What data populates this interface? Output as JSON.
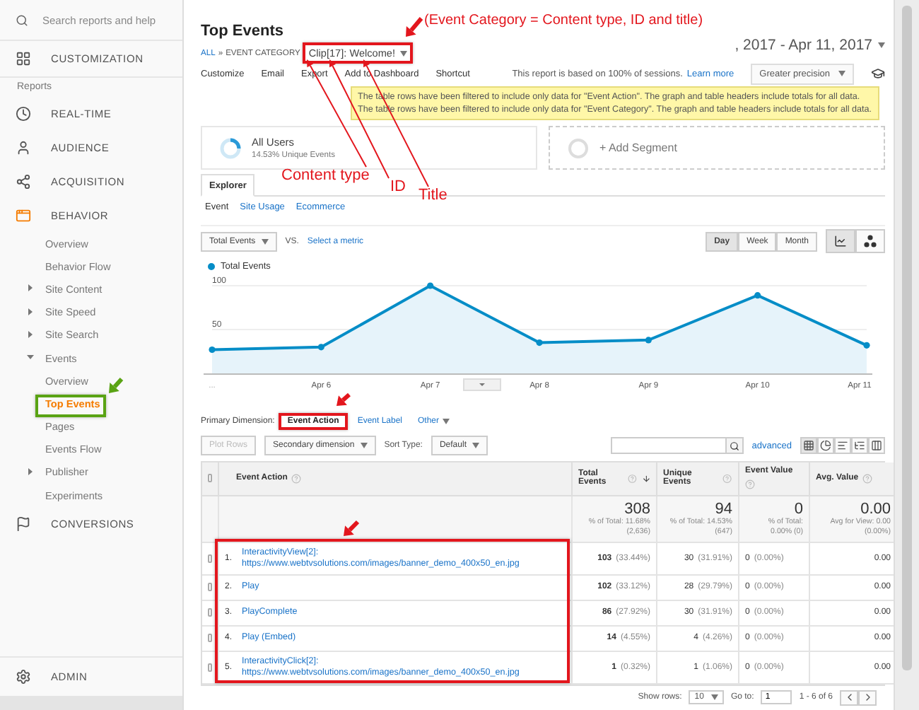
{
  "sidebar": {
    "search": {
      "placeholder": "Search reports and help"
    },
    "customization": "CUSTOMIZATION",
    "reports_heading": "Reports",
    "items": [
      {
        "label": "REAL-TIME",
        "selected": false
      },
      {
        "label": "AUDIENCE",
        "selected": false
      },
      {
        "label": "ACQUISITION",
        "selected": false
      },
      {
        "label": "BEHAVIOR",
        "selected": true,
        "children": [
          {
            "label": "Overview",
            "selected": false
          },
          {
            "label": "Behavior Flow",
            "selected": false
          },
          {
            "label": "Site Content",
            "selected": false,
            "expanded": false
          },
          {
            "label": "Site Speed",
            "selected": false,
            "expanded": false
          },
          {
            "label": "Site Search",
            "selected": false,
            "expanded": false
          },
          {
            "label": "Events",
            "selected": false,
            "expanded": true,
            "children": [
              {
                "label": "Overview",
                "selected": false
              },
              {
                "label": "Top Events",
                "selected": true
              },
              {
                "label": "Pages",
                "selected": false
              },
              {
                "label": "Events Flow",
                "selected": false
              }
            ]
          },
          {
            "label": "Publisher",
            "selected": false,
            "expanded": false
          },
          {
            "label": "Experiments",
            "selected": false
          }
        ]
      },
      {
        "label": "CONVERSIONS",
        "selected": false
      }
    ],
    "admin": "ADMIN"
  },
  "header": {
    "title": "Top Events",
    "breadcrumb": {
      "root": "ALL",
      "separator": "»",
      "level": "EVENT CATEGORY",
      "value": "Clip[17]: Welcome!"
    },
    "date_range": ", 2017 - Apr 11, 2017"
  },
  "toolbar": {
    "actions": [
      "Customize",
      "Email",
      "Export",
      "Add to Dashboard",
      "Shortcut"
    ],
    "sampling_text": "This report is based on 100% of sessions.",
    "learn_more": "Learn more",
    "precision": "Greater precision"
  },
  "notice": [
    "The table rows have been filtered to include only data for \"Event Action\". The graph and table headers include totals for all data.",
    "The table rows have been filtered to include only data for \"Event Category\". The graph and table headers include totals for all data."
  ],
  "segments": [
    {
      "name": "All Users",
      "detail": "14.53% Unique Events"
    }
  ],
  "add_segment": "+ Add Segment",
  "tabs": [
    {
      "label": "Explorer",
      "selected": true
    }
  ],
  "subtabs": [
    {
      "label": "Event",
      "selected": true
    },
    {
      "label": "Site Usage",
      "selected": false
    },
    {
      "label": "Ecommerce",
      "selected": false
    }
  ],
  "chart_controls": {
    "metric": "Total Events",
    "vs": "VS.",
    "select_metric": "Select a metric",
    "granularity": [
      {
        "label": "Day",
        "selected": true
      },
      {
        "label": "Week",
        "selected": false
      },
      {
        "label": "Month",
        "selected": false
      }
    ]
  },
  "chart": {
    "chart_data": {
      "type": "area",
      "categories": [
        "...",
        "Apr 6",
        "Apr 7",
        "Apr 8",
        "Apr 9",
        "Apr 10",
        "Apr 11"
      ],
      "ylim": [
        0,
        100
      ],
      "yticks": [
        {
          "value": 50,
          "label": "50"
        },
        {
          "value": 100,
          "label": "100"
        }
      ],
      "series": [
        {
          "name": "Total Events",
          "color": "#058dc7",
          "values": [
            27,
            30,
            100,
            35,
            38,
            89,
            32
          ]
        }
      ]
    }
  },
  "primary_dimension": {
    "label": "Primary Dimension:",
    "options": [
      {
        "label": "Event Action",
        "selected": true
      },
      {
        "label": "Event Label",
        "selected": false
      },
      {
        "label": "Other",
        "selected": false
      }
    ]
  },
  "table_controls": {
    "plot_rows": "Plot Rows",
    "plot_rows_disabled": true,
    "secondary_dimension": "Secondary dimension",
    "sort_label": "Sort Type:",
    "sort": "Default",
    "advanced": "advanced"
  },
  "table": {
    "select_all_checked": false,
    "columns": [
      "Event Action",
      "Total Events",
      "Unique Events",
      "Event Value",
      "Avg. Value"
    ],
    "totals": [
      {
        "value": "308",
        "note": "% of Total: 11.68% (2,636)"
      },
      {
        "value": "94",
        "note": "% of Total: 14.53% (647)"
      },
      {
        "value": "0",
        "note": "% of Total: 0.00% (0)"
      },
      {
        "value": "0.00",
        "note": "Avg for View: 0.00 (0.00%)"
      }
    ],
    "rows": [
      {
        "index": "1.",
        "action": "InteractivityView[2]: https://www.webtvsolutions.com/images/banner_demo_400x50_en.jpg",
        "checked": false,
        "total": "103",
        "total_pct": "(33.44%)",
        "unique": "30",
        "unique_pct": "(31.91%)",
        "value": "0",
        "value_pct": "(0.00%)",
        "avg": "0.00"
      },
      {
        "index": "2.",
        "action": "Play",
        "checked": false,
        "total": "102",
        "total_pct": "(33.12%)",
        "unique": "28",
        "unique_pct": "(29.79%)",
        "value": "0",
        "value_pct": "(0.00%)",
        "avg": "0.00"
      },
      {
        "index": "3.",
        "action": "PlayComplete",
        "checked": false,
        "total": "86",
        "total_pct": "(27.92%)",
        "unique": "30",
        "unique_pct": "(31.91%)",
        "value": "0",
        "value_pct": "(0.00%)",
        "avg": "0.00"
      },
      {
        "index": "4.",
        "action": "Play (Embed)",
        "checked": false,
        "total": "14",
        "total_pct": "(4.55%)",
        "unique": "4",
        "unique_pct": "(4.26%)",
        "value": "0",
        "value_pct": "(0.00%)",
        "avg": "0.00"
      },
      {
        "index": "5.",
        "action": "InteractivityClick[2]: https://www.webtvsolutions.com/images/banner_demo_400x50_en.jpg",
        "checked": false,
        "total": "1",
        "total_pct": "(0.32%)",
        "unique": "1",
        "unique_pct": "(1.06%)",
        "value": "0",
        "value_pct": "(0.00%)",
        "avg": "0.00"
      }
    ],
    "footer": {
      "show_rows_label": "Show rows:",
      "show_rows": "10",
      "goto_label": "Go to:",
      "goto": "1",
      "range": "1 - 6 of 6"
    }
  },
  "annotations": {
    "title_note": "(Event Category = Content type, ID and title)",
    "labels": [
      "Content type",
      "ID",
      "Title"
    ]
  }
}
